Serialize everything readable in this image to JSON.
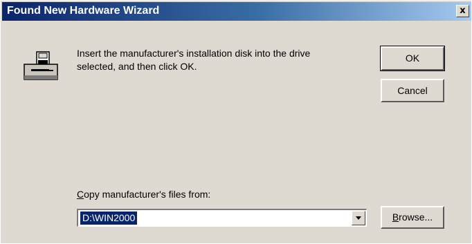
{
  "window": {
    "title": "Found New Hardware Wizard",
    "close_glyph": "x"
  },
  "message": {
    "line1": "Insert the manufacturer's installation disk into the drive",
    "line2": "selected, and then click OK."
  },
  "buttons": {
    "ok": "OK",
    "cancel": "Cancel",
    "browse_first": "B",
    "browse_rest": "rowse..."
  },
  "copy_from": {
    "label_first": "C",
    "label_rest": "opy manufacturer's files from:",
    "value": "D:\\WIN2000"
  },
  "icons": {
    "disk": "floppy-disk-drive-icon",
    "dropdown": "chevron-down-icon"
  }
}
